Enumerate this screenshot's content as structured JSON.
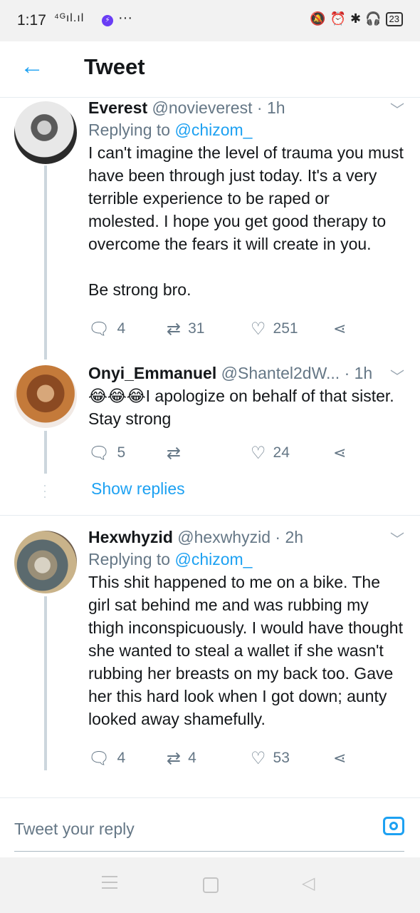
{
  "status_bar": {
    "time": "1:17",
    "signal": "⁴ᴳıl.ıl",
    "messenger_icon": "messenger-icon",
    "more": "···",
    "battery": "23"
  },
  "header": {
    "back_icon": "back-arrow-icon",
    "title": "Tweet"
  },
  "tweets": [
    {
      "name": "Everest",
      "handle": "@novieverest",
      "separator": "·",
      "time": "1h",
      "replying_prefix": "Replying to",
      "replying_to": "@chizom_",
      "text": "I can't imagine the level of trauma you must have been through just today. It's a very terrible experience to be raped or molested. I hope you get good therapy to overcome the fears it will create in you.\n\nBe strong bro.",
      "replies": "4",
      "retweets": "31",
      "likes": "251"
    },
    {
      "name": "Onyi_Emmanuel",
      "handle": "@Shantel2dW...",
      "separator": "·",
      "time": "1h",
      "text": "😂😂😂I apologize on behalf of that sister.  Stay strong",
      "replies": "5",
      "retweets": "",
      "likes": "24",
      "show_replies": "Show replies"
    },
    {
      "name": "Hexwhyzid",
      "handle": "@hexwhyzid",
      "separator": "·",
      "time": "2h",
      "replying_prefix": "Replying to",
      "replying_to": "@chizom_",
      "text": "This shit happened to me on a bike. The girl sat behind me and was rubbing my thigh inconspicuously. I would have thought she wanted to steal a wallet if she wasn't rubbing her breasts on my back too. Gave her this hard look when I got down; aunty looked away shamefully.",
      "replies": "4",
      "retweets": "4",
      "likes": "53"
    }
  ],
  "reply_bar": {
    "placeholder": "Tweet your reply",
    "camera_icon": "camera-icon"
  },
  "colors": {
    "accent": "#1da1f2",
    "secondary_text": "#657786",
    "divider": "#e6ecf0"
  }
}
